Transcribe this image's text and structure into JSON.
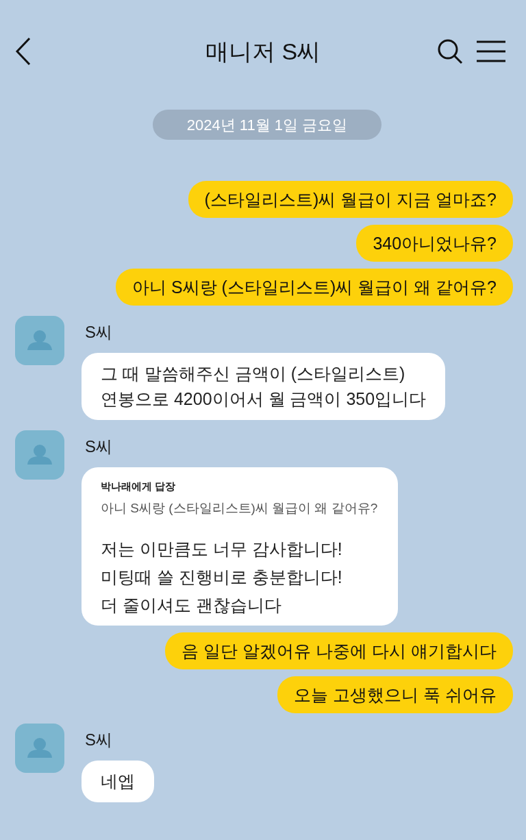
{
  "header": {
    "title": "매니저 S씨"
  },
  "date_divider": "2024년 11월 1일 금요일",
  "messages": [
    {
      "kind": "sent",
      "text": "(스타일리스트)씨 월급이 지금 얼마죠?"
    },
    {
      "kind": "sent",
      "text": "340아니었나유?"
    },
    {
      "kind": "sent",
      "text": "아니 S씨랑 (스타일리스트)씨 월급이 왜 같어유?"
    },
    {
      "kind": "received",
      "sender": "S씨",
      "text": "그 때 말씀해주신 금액이 (스타일리스트)\n연봉으로 4200이어서 월 금액이 350입니다"
    },
    {
      "kind": "received",
      "sender": "S씨",
      "reply_to": {
        "label": "박나래에게 답장",
        "quote": "아니 S씨랑 (스타일리스트)씨 월급이 왜 같어유?"
      },
      "text": "저는 이만큼도 너무 감사합니다!\n미팅때 쓸 진행비로 충분합니다!\n더 줄이셔도 괜찮습니다"
    },
    {
      "kind": "sent",
      "text": "음 일단 알겠어유 나중에 다시 얘기합시다"
    },
    {
      "kind": "sent",
      "text": "오늘 고생했으니 푹 쉬어유"
    },
    {
      "kind": "received",
      "sender": "S씨",
      "text": "네엡"
    }
  ]
}
